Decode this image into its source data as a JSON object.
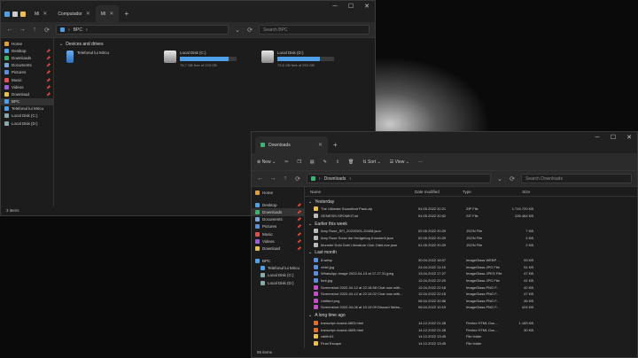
{
  "win1": {
    "tabs": [
      {
        "label": "Mi"
      },
      {
        "label": "Computador"
      },
      {
        "label": "Mí"
      }
    ],
    "add_tab": "+",
    "addr": {
      "path": "BPC",
      "search_placeholder": "Search BPC"
    },
    "sidebar": {
      "items": [
        {
          "label": "Home",
          "icon": "home-icon",
          "color": "#e0a040"
        },
        {
          "label": "Desktop",
          "icon": "desktop-icon",
          "color": "#4ea1e8",
          "pin": true
        },
        {
          "label": "Downloads",
          "icon": "downloads-icon",
          "color": "#3cb371",
          "pin": true
        },
        {
          "label": "Documents",
          "icon": "documents-icon",
          "color": "#7aa7d8",
          "pin": true
        },
        {
          "label": "Pictures",
          "icon": "pictures-icon",
          "color": "#5a8fd8",
          "pin": true
        },
        {
          "label": "Music",
          "icon": "music-icon",
          "color": "#e05050",
          "pin": true
        },
        {
          "label": "Videos",
          "icon": "videos-icon",
          "color": "#9a60d8",
          "pin": true
        },
        {
          "label": "Download",
          "icon": "folder-icon",
          "color": "#e8c050",
          "pin": true
        },
        {
          "label": "BPC",
          "icon": "computer-icon",
          "color": "#4ea1e8",
          "sel": true
        },
        {
          "label": "Telefonul lui Mircu",
          "icon": "phone-icon",
          "color": "#4ea1e8"
        },
        {
          "label": "Local Disk (C:)",
          "icon": "drive-icon",
          "color": "#8aa"
        },
        {
          "label": "Local Disk (D:)",
          "icon": "drive-icon",
          "color": "#8aa"
        }
      ]
    },
    "section": "Devices and drives",
    "drives": [
      {
        "name": "Telefonul lui Mircu",
        "bar": null,
        "free": ""
      },
      {
        "name": "Local Disk (C:)",
        "bar": 0.86,
        "free": "78,7 GB free of 223 GB"
      },
      {
        "name": "Local Disk (D:)",
        "bar": 0.75,
        "free": "72,8 GB free of 293 GB"
      }
    ],
    "status": "3 items"
  },
  "win2": {
    "tabs": [
      {
        "label": "Downloads"
      }
    ],
    "add_tab": "+",
    "toolbar": {
      "new": "New",
      "sort": "Sort",
      "view": "View"
    },
    "addr": {
      "path": "Downloads",
      "search_placeholder": "Search Downloads"
    },
    "sidebar": {
      "items": [
        {
          "label": "Home",
          "icon": "home-icon",
          "color": "#e0a040"
        },
        {
          "label": "Desktop",
          "icon": "desktop-icon",
          "color": "#4ea1e8",
          "pin": true,
          "gap": true
        },
        {
          "label": "Downloads",
          "icon": "downloads-icon",
          "color": "#3cb371",
          "pin": true,
          "sel": true
        },
        {
          "label": "Documents",
          "icon": "documents-icon",
          "color": "#7aa7d8",
          "pin": true
        },
        {
          "label": "Pictures",
          "icon": "pictures-icon",
          "color": "#5a8fd8",
          "pin": true
        },
        {
          "label": "Music",
          "icon": "music-icon",
          "color": "#e05050",
          "pin": true
        },
        {
          "label": "Videos",
          "icon": "videos-icon",
          "color": "#9a60d8",
          "pin": true
        },
        {
          "label": "Download",
          "icon": "folder-icon",
          "color": "#e8c050",
          "pin": true
        },
        {
          "label": "BPC",
          "icon": "computer-icon",
          "color": "#4ea1e8",
          "gap": true
        },
        {
          "label": "Telefonul lui Mircu",
          "icon": "phone-icon",
          "color": "#4ea1e8",
          "sub": true
        },
        {
          "label": "Local Disk (C:)",
          "icon": "drive-icon",
          "color": "#8aa",
          "sub": true
        },
        {
          "label": "Local Disk (D:)",
          "icon": "drive-icon",
          "color": "#8aa",
          "sub": true
        }
      ]
    },
    "columns": {
      "name": "Name",
      "date": "Date modified",
      "type": "Type",
      "size": "Size"
    },
    "groups": [
      {
        "label": "Yesterday",
        "rows": [
          {
            "name": "The Ultimate Soundfont Pack.zip",
            "date": "04.05.2022 20:21",
            "type": "ZIP File",
            "size": "1.719.720 KB",
            "color": "#e8c050"
          },
          {
            "name": "GENESIS-SROMKIT.sit",
            "date": "04.05.2022 20:02",
            "type": "SIT File",
            "size": "226.464 KB",
            "color": "#bbb"
          }
        ]
      },
      {
        "label": "Earlier this week",
        "rows": [
          {
            "name": "Amy Rose_SFI_20220901-20408.json",
            "date": "02.05.2022 20:25",
            "type": "JSON File",
            "size": "7 KB",
            "color": "#bbb"
          },
          {
            "name": "Amy Rose Sonic the Hedgehog Knockerit.json",
            "date": "02.05.2022 20:25",
            "type": "JSON File",
            "size": "4 KB",
            "color": "#bbb"
          },
          {
            "name": "Monster Dohi Dohi Literature Club Orbit.eve.json",
            "date": "01.05.2022 20:25",
            "type": "JSON File",
            "size": "2 KB",
            "color": "#bbb"
          }
        ]
      },
      {
        "label": "Last month",
        "rows": [
          {
            "name": "8.webp",
            "date": "30.04.2022 16:07",
            "type": "ImageGlass WEBP ...",
            "size": "93 KB",
            "color": "#5a8fd8"
          },
          {
            "name": "vrbkt.jpg",
            "date": "24.04.2022 11:15",
            "type": "ImageGlass JPG File",
            "size": "51 KB",
            "color": "#5a8fd8"
          },
          {
            "name": "WhatsApp Image 2022-04-13 at 17.27.31.jpeg",
            "date": "13.04.2022 17:27",
            "type": "ImageGlass JPEG File",
            "size": "47 KB",
            "color": "#5a8fd8"
          },
          {
            "name": "font.jpg",
            "date": "12.04.2022 22:20",
            "type": "ImageGlass JPG File",
            "size": "41 KB",
            "color": "#5a8fd8"
          },
          {
            "name": "Screenshot 2022-04-12 at 22.18.58 Chat now with...",
            "date": "12.04.2022 22:18",
            "type": "ImageGlass PNG F...",
            "size": "42 KB",
            "color": "#c050c0"
          },
          {
            "name": "Screenshot 2022-04-12 at 22.15.02 Chat now with...",
            "date": "12.04.2022 22:15",
            "type": "ImageGlass PNG F...",
            "size": "47 KB",
            "color": "#c050c0"
          },
          {
            "name": "Untitled.png",
            "date": "08.04.2022 20:56",
            "type": "ImageGlass PNG F...",
            "size": "46 KB",
            "color": "#c050c0"
          },
          {
            "name": "Screenshot 2022-04-06 at 10.19.09 Discord Webs...",
            "date": "06.04.2022 10:19",
            "type": "ImageGlass PNG F...",
            "size": "424 KB",
            "color": "#c050c0"
          }
        ]
      },
      {
        "label": "A long time ago",
        "rows": [
          {
            "name": "transcript closed-4803.html",
            "date": "14.12.2022 21:28",
            "type": "Firefox HTML Doc...",
            "size": "1.183 KB",
            "color": "#e07030"
          },
          {
            "name": "transcript closed-4805.html",
            "date": "14.12.2022 21:28",
            "type": "Firefox HTML Doc...",
            "size": "30 KB",
            "color": "#e07030"
          },
          {
            "name": "vdkfm11",
            "date": "14.12.2022 13:45",
            "type": "File folder",
            "size": "",
            "color": "#e8c050"
          },
          {
            "name": "Final Escape",
            "date": "14.12.2022 13:45",
            "type": "File folder",
            "size": "",
            "color": "#e8c050"
          }
        ]
      }
    ],
    "status": "55 items"
  }
}
